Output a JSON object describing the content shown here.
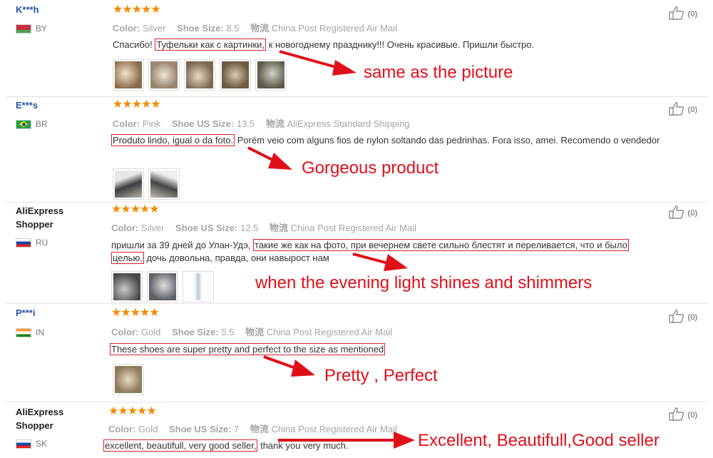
{
  "reviews": [
    {
      "user": "K***h",
      "country": "BY",
      "stars": "★★★★★",
      "color_label": "Color:",
      "color_value": "Silver",
      "size_label": "Shoe Size:",
      "size_value": "8.5",
      "logistics_label": "物流",
      "logistics_value": "China Post Registered Air Mail",
      "comment_before": "Спасибо! ",
      "comment_highlight": "Туфельки как с картинки,",
      "comment_after": " к новогоднему празднику!!! Очень красивые. Пришли быстро.",
      "likes": "(0)",
      "annotation": "same as the picture"
    },
    {
      "user": "E***s",
      "country": "BR",
      "stars": "★★★★★",
      "color_label": "Color:",
      "color_value": "Pink",
      "size_label": "Shoe US Size:",
      "size_value": "13.5",
      "logistics_label": "物流",
      "logistics_value": "AliExpress Standard Shipping",
      "comment_before": "",
      "comment_highlight": "Produto lindo, igual o da foto.",
      "comment_after": " Porém veio com alguns fios de nylon soltando das pedrinhas. Fora isso, amei. Recomendo o vendedor",
      "likes": "(0)",
      "annotation": "Gorgeous product"
    },
    {
      "user": "AliExpress Shopper",
      "country": "RU",
      "stars": "★★★★★",
      "color_label": "Color:",
      "color_value": "Silver",
      "size_label": "Shoe US Size:",
      "size_value": "12.5",
      "logistics_label": "物流",
      "logistics_value": "China Post Registered Air Mail",
      "comment_before": "пришли за 39 дней до Улан-Удэ, ",
      "comment_highlight": "такие же как на фото, при вечернем свете сильно блестят и переливается, что и было",
      "comment_line2_highlight": "целью,",
      "comment_after": " дочь довольна, правда, они навырост нам",
      "likes": "(0)",
      "annotation": "when the evening light shines and shimmers"
    },
    {
      "user": "P***i",
      "country": "IN",
      "stars": "★★★★★",
      "color_label": "Color:",
      "color_value": "Gold",
      "size_label": "Shoe Size:",
      "size_value": "5.5",
      "logistics_label": "物流",
      "logistics_value": "China Post Registered Air Mail",
      "comment_before": "",
      "comment_highlight": "These shoes are super pretty and perfect to the size as mentioned",
      "comment_after": "",
      "likes": "(0)",
      "annotation": "Pretty , Perfect"
    },
    {
      "user": "AliExpress Shopper",
      "country": "SK",
      "stars": "★★★★★",
      "color_label": "Color:",
      "color_value": "Gold",
      "size_label": "Shoe US Size:",
      "size_value": "7",
      "logistics_label": "物流",
      "logistics_value": "China Post Registered Air Mail",
      "comment_before": "",
      "comment_highlight": "excellent, beautifull, very good seller,",
      "comment_after": " thank you very much.",
      "likes": "(0)",
      "annotation": "Excellent, Beautifull,Good seller"
    }
  ],
  "colors": {
    "accent_red": "#e0101a",
    "star_orange": "#f58a00",
    "link_blue": "#2356a6"
  }
}
